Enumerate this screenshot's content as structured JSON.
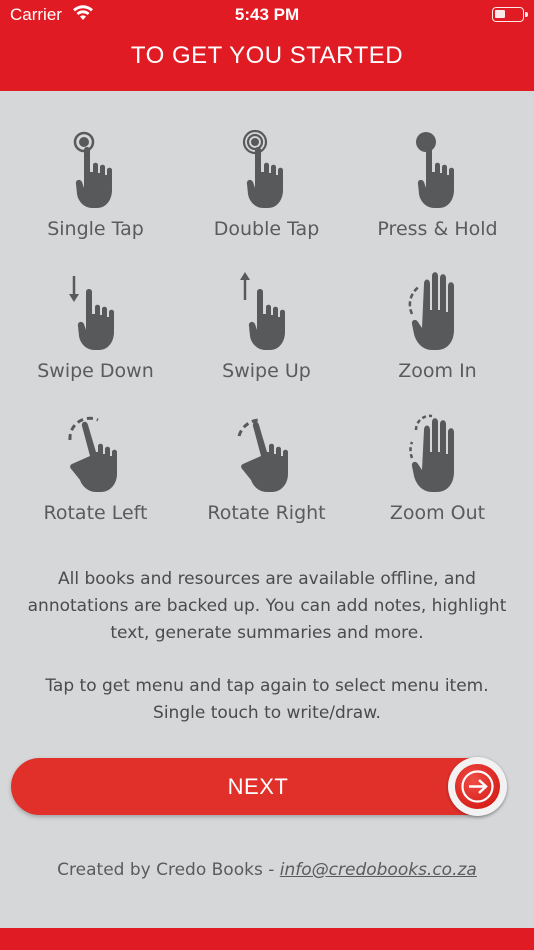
{
  "status": {
    "carrier": "Carrier",
    "time": "5:43 PM"
  },
  "header": {
    "title": "TO GET YOU STARTED"
  },
  "gestures": [
    {
      "label": "Single Tap",
      "icon": "single-tap-icon"
    },
    {
      "label": "Double Tap",
      "icon": "double-tap-icon"
    },
    {
      "label": "Press & Hold",
      "icon": "press-hold-icon"
    },
    {
      "label": "Swipe Down",
      "icon": "swipe-down-icon"
    },
    {
      "label": "Swipe Up",
      "icon": "swipe-up-icon"
    },
    {
      "label": "Zoom In",
      "icon": "zoom-in-icon"
    },
    {
      "label": "Rotate Left",
      "icon": "rotate-left-icon"
    },
    {
      "label": "Rotate Right",
      "icon": "rotate-right-icon"
    },
    {
      "label": "Zoom Out",
      "icon": "zoom-out-icon"
    }
  ],
  "description": {
    "line1": "All books and resources are available offline, and",
    "line2": "annotations are backed up. You can add notes, highlight",
    "line3": "text, generate summaries and more.",
    "line4": "Tap to get menu and tap again to select menu item.",
    "line5": "Single touch to write/draw."
  },
  "next_button": {
    "label": "NEXT"
  },
  "footer": {
    "prefix": "Created by Credo Books - ",
    "email": "info@credobooks.co.za"
  },
  "colors": {
    "brand_red": "#e11b23",
    "icon_gray": "#58595b",
    "background": "#d6d7d9"
  }
}
